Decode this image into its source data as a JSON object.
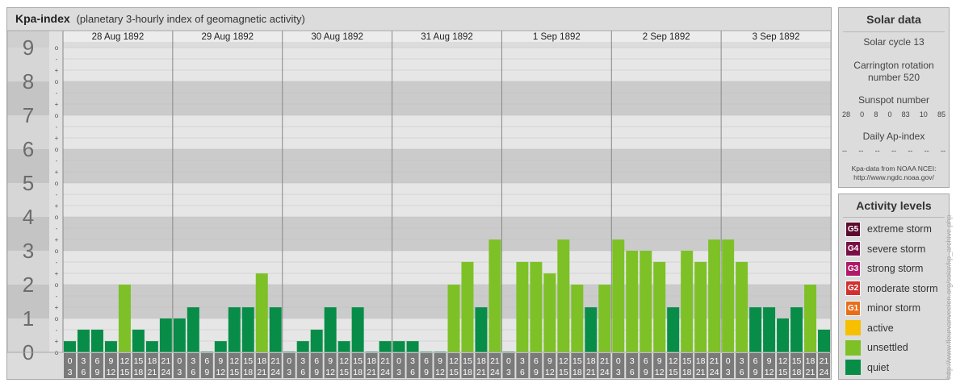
{
  "header": {
    "title": "Kpa-index",
    "subtitle": "(planetary 3-hourly index of geomagnetic activity)"
  },
  "solar": {
    "title": "Solar data",
    "cycle": "Solar cycle 13",
    "carrington_line1": "Carrington rotation",
    "carrington_line2": "number 520",
    "sunspot_title": "Sunspot number",
    "sunspot_values": [
      "28",
      "0",
      "8",
      "0",
      "83",
      "10",
      "85"
    ],
    "ap_title": "Daily Ap-index",
    "ap_values": [
      "--",
      "--",
      "--",
      "--",
      "--",
      "--",
      "--"
    ],
    "source_line1": "Kpa-data from NOAA NCEI:",
    "source_line2": "http://www.ngdc.noaa.gov/"
  },
  "levels": {
    "title": "Activity levels",
    "items": [
      {
        "badge": "G5",
        "label": "extreme storm",
        "color": "#5c0a2e"
      },
      {
        "badge": "G4",
        "label": "severe storm",
        "color": "#7a0f46"
      },
      {
        "badge": "G3",
        "label": "strong storm",
        "color": "#b01868"
      },
      {
        "badge": "G2",
        "label": "moderate storm",
        "color": "#d22f2f"
      },
      {
        "badge": "G1",
        "label": "minor storm",
        "color": "#e86e1a"
      },
      {
        "badge": "",
        "label": "active",
        "color": "#f6c000"
      },
      {
        "badge": "",
        "label": "unsettled",
        "color": "#7dc127"
      },
      {
        "badge": "",
        "label": "quiet",
        "color": "#078d47"
      }
    ]
  },
  "credit": "http://www.fleurvanveelen.org/solar/kp_archive.php",
  "chart_data": {
    "type": "bar",
    "y_ticks": [
      "0",
      "1",
      "2",
      "3",
      "4",
      "5",
      "6",
      "7",
      "8",
      "9"
    ],
    "y_sublabels": [
      "+",
      "o",
      "-"
    ],
    "ylim": [
      0,
      9
    ],
    "days": [
      "28 Aug 1892",
      "29 Aug 1892",
      "30 Aug 1892",
      "31 Aug 1892",
      "1 Sep 1892",
      "2 Sep 1892",
      "3 Sep 1892"
    ],
    "hour_labels_top": [
      "0",
      "3",
      "6",
      "9",
      "12",
      "15",
      "18",
      "21"
    ],
    "hour_labels_bottom": [
      "3",
      "6",
      "9",
      "12",
      "15",
      "18",
      "21",
      "24"
    ],
    "values": [
      [
        0.33,
        0.67,
        0.67,
        0.33,
        2.0,
        0.67,
        0.33,
        1.0
      ],
      [
        1.0,
        1.33,
        0.0,
        0.33,
        1.33,
        1.33,
        2.33,
        1.33
      ],
      [
        0.0,
        0.33,
        0.67,
        1.33,
        0.33,
        1.33,
        0.0,
        0.33
      ],
      [
        0.33,
        0.33,
        0.0,
        0.0,
        2.0,
        2.67,
        1.33,
        3.33
      ],
      [
        0.0,
        2.67,
        2.67,
        2.33,
        3.33,
        2.0,
        1.33,
        2.0
      ],
      [
        3.33,
        3.0,
        3.0,
        2.67,
        1.33,
        3.0,
        2.67,
        3.33
      ],
      [
        3.33,
        2.67,
        1.33,
        1.33,
        1.0,
        1.33,
        2.0,
        0.67
      ]
    ],
    "colors": {
      "quiet": "#078d47",
      "unsettled": "#7dc127",
      "active": "#f6c000"
    }
  }
}
